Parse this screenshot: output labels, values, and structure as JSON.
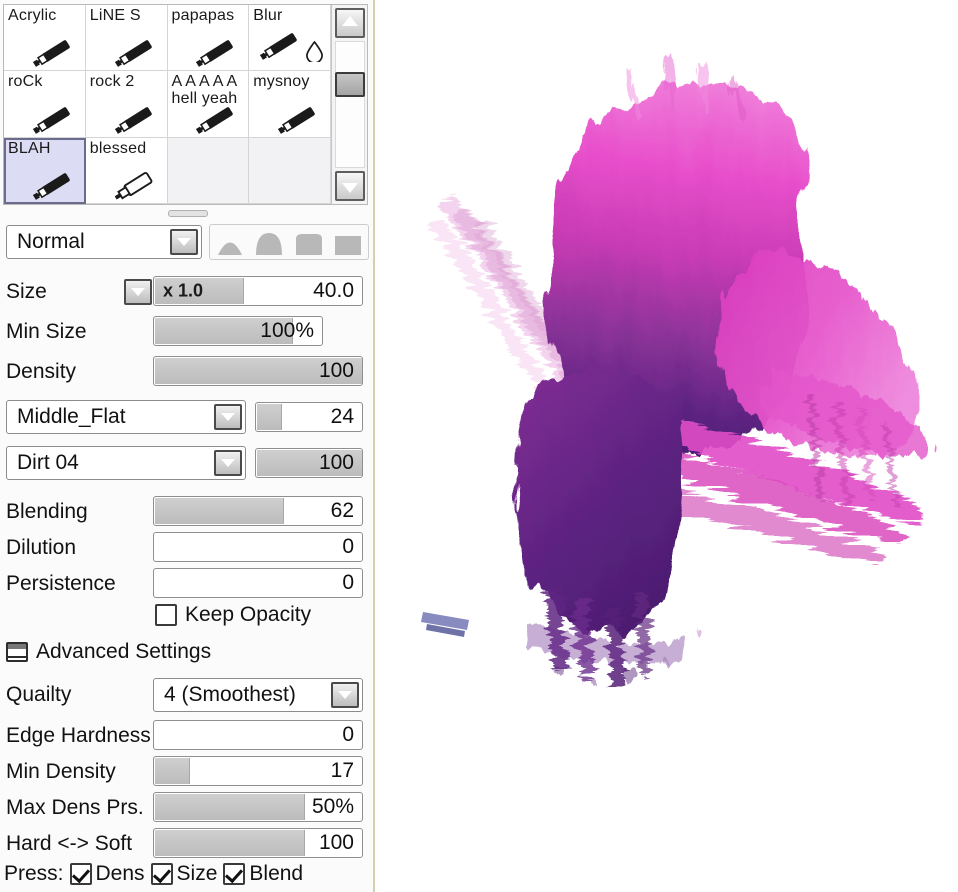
{
  "panel": {
    "brush_grid": {
      "brushes": [
        {
          "name": "Acrylic",
          "icon": "pen-icon",
          "selected": false,
          "empty": false
        },
        {
          "name": "LiNE S",
          "icon": "pen-icon",
          "selected": false,
          "empty": false
        },
        {
          "name": "papapas",
          "icon": "pen-icon",
          "selected": false,
          "empty": false
        },
        {
          "name": "Blur",
          "icon": "pen-water-drop-icon",
          "selected": false,
          "empty": false
        },
        {
          "name": "roCk",
          "icon": "pen-icon",
          "selected": false,
          "empty": false
        },
        {
          "name": "rock 2",
          "icon": "pen-icon",
          "selected": false,
          "empty": false
        },
        {
          "name": "A A A A A\nhell yeah",
          "icon": "pen-icon",
          "selected": false,
          "empty": false
        },
        {
          "name": "mysnoy",
          "icon": "pen-icon",
          "selected": false,
          "empty": false
        },
        {
          "name": "BLAH",
          "icon": "pen-icon",
          "selected": true,
          "empty": false
        },
        {
          "name": "blessed",
          "icon": "marker-icon",
          "selected": false,
          "empty": false
        },
        {
          "name": "",
          "icon": "",
          "selected": false,
          "empty": true
        },
        {
          "name": "",
          "icon": "",
          "selected": false,
          "empty": true
        }
      ],
      "scrollbar": {
        "up_arrow": "scroll-up-icon",
        "down_arrow": "scroll-down-icon",
        "thumb_position_pct": 30
      }
    },
    "blend_mode": {
      "label": "Normal",
      "dropdown_icon": "chevron-down-icon"
    },
    "shape_presets": [
      {
        "name": "shape-soft-round",
        "hardness": 0
      },
      {
        "name": "shape-medium-round",
        "hardness": 35
      },
      {
        "name": "shape-hard-round",
        "hardness": 70
      },
      {
        "name": "shape-flat-square",
        "hardness": 100
      }
    ],
    "size": {
      "label": "Size",
      "dropdown_icon": "chevron-down-icon",
      "multiplier": "x 1.0",
      "value": "40.0",
      "fill_pct": 43
    },
    "min_size": {
      "label": "Min Size",
      "value": "100%",
      "fill_pct": 82
    },
    "density": {
      "label": "Density",
      "value": "100",
      "fill_pct": 100
    },
    "shape_texture": {
      "label": "Middle_Flat",
      "dropdown_icon": "chevron-down-icon",
      "value": "24",
      "fill_pct": 24
    },
    "paper_texture": {
      "label": "Dirt 04",
      "dropdown_icon": "chevron-down-icon",
      "value": "100",
      "fill_pct": 100
    },
    "blending": {
      "label": "Blending",
      "value": "62",
      "fill_pct": 62
    },
    "dilution": {
      "label": "Dilution",
      "value": "0",
      "fill_pct": 0
    },
    "persistence": {
      "label": "Persistence",
      "value": "0",
      "fill_pct": 0
    },
    "keep_opacity": {
      "label": "Keep Opacity",
      "checked": false
    },
    "advanced_settings": {
      "label": "Advanced Settings",
      "icon": "panel-collapse-icon",
      "expanded": true
    },
    "quality": {
      "label": "Quailty",
      "value": "4 (Smoothest)",
      "dropdown_icon": "chevron-down-icon"
    },
    "edge_hardness": {
      "label": "Edge Hardness",
      "value": "0",
      "fill_pct": 0
    },
    "min_density": {
      "label": "Min Density",
      "value": "17",
      "fill_pct": 17
    },
    "max_dens_prs": {
      "label": "Max Dens Prs.",
      "value": "50%",
      "fill_pct": 72
    },
    "hard_soft": {
      "label": "Hard <-> Soft",
      "value": "100",
      "fill_pct": 72
    },
    "pressure": {
      "label": "Press:",
      "options": [
        {
          "label": "Dens",
          "checked": true
        },
        {
          "label": "Size",
          "checked": true
        },
        {
          "label": "Blend",
          "checked": true
        }
      ]
    }
  },
  "canvas": {
    "background": "#ffffff",
    "artwork_name": "brush-stroke-painting",
    "colors": {
      "magenta": "#e048c8",
      "magenta_light": "#ec77d6",
      "magenta_deep": "#d02fb4",
      "purple": "#6a2a8e",
      "purple_deep": "#4e1f73",
      "mid_violet": "#9b3fa8"
    }
  },
  "theme": {
    "panel_bg": "#fbfbfb",
    "panel_border": "#d8cfae",
    "selection_bg": "#dcdcf4",
    "slider_fill": "#c6c6c6"
  }
}
